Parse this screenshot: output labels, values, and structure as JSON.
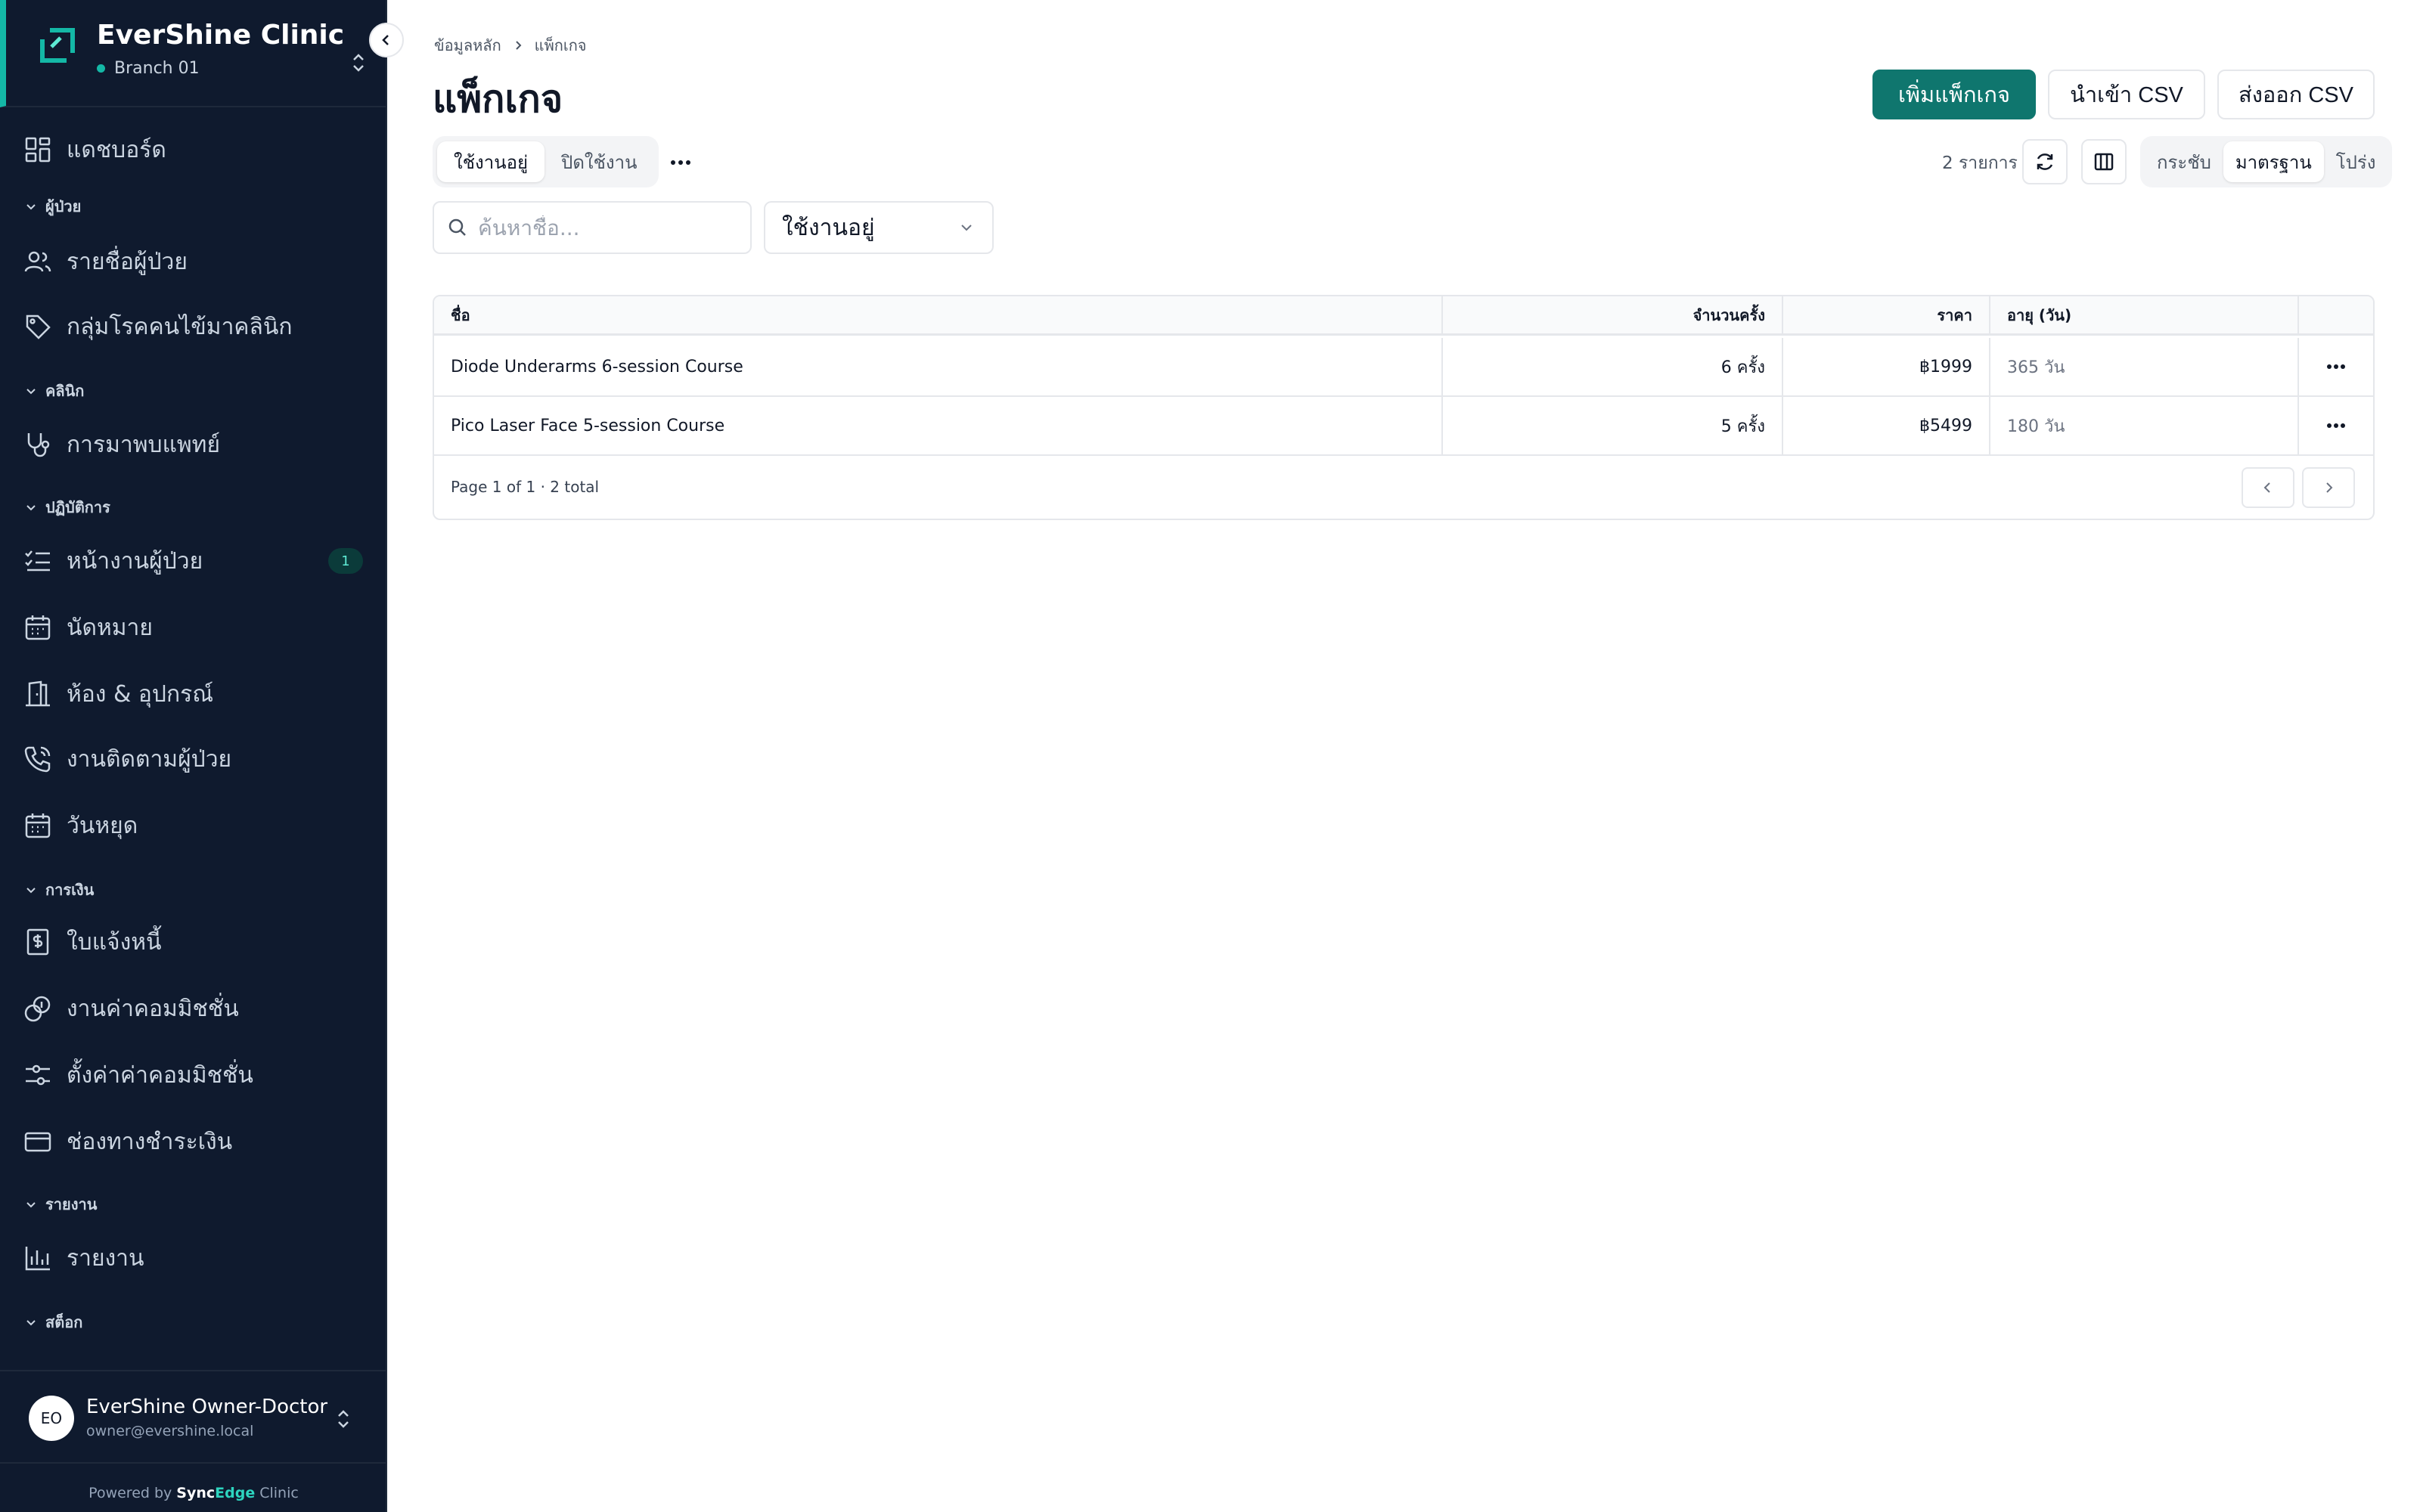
{
  "sidebar": {
    "brand_title": "EverShine Clinic",
    "branch": "Branch 01",
    "accent_color": "#14b8a6",
    "items": {
      "dashboard": "แดชบอร์ด",
      "section_patients": "ผู้ป่วย",
      "patient_list": "รายชื่อผู้ป่วย",
      "disease_groups": "กลุ่มโรคคนไข้มาคลินิก",
      "section_clinic": "คลินิก",
      "doctor_visits": "การมาพบแพทย์",
      "section_operations": "ปฏิบัติการ",
      "patient_tasks": "หน้างานผู้ป่วย",
      "patient_tasks_badge": "1",
      "appointments": "นัดหมาย",
      "rooms_equipment": "ห้อง & อุปกรณ์",
      "patient_followup": "งานติดตามผู้ป่วย",
      "holidays": "วันหยุด",
      "section_finance": "การเงิน",
      "invoices": "ใบแจ้งหนี้",
      "commission_jobs": "งานค่าคอมมิชชั่น",
      "commission_settings": "ตั้งค่าค่าคอมมิชชั่น",
      "payment_channels": "ช่องทางชำระเงิน",
      "section_reports": "รายงาน",
      "reports": "รายงาน",
      "section_stock": "สต็อก"
    },
    "user": {
      "initials": "EO",
      "name": "EverShine Owner-Doctor",
      "email": "owner@evershine.local"
    },
    "powered_prefix": "Powered by",
    "powered_brand_a": "Sync",
    "powered_brand_b": "Edge",
    "powered_suffix": "Clinic"
  },
  "breadcrumb": [
    "ข้อมูลหลัก",
    "แพ็กเกจ"
  ],
  "page_title": "แพ็กเกจ",
  "actions": {
    "add": "เพิ่มแพ็กเกจ",
    "import": "นำเข้า CSV",
    "export": "ส่งออก CSV",
    "primary_color": "#0f766e"
  },
  "status_tabs": {
    "active": "ใช้งานอยู่",
    "inactive": "ปิดใช้งาน"
  },
  "record_count": "2 รายการ",
  "density": {
    "compact": "กระชับ",
    "standard": "มาตรฐาน",
    "comfortable": "โปร่ง",
    "selected": "standard"
  },
  "search": {
    "placeholder": "ค้นหาชื่อ...",
    "value": ""
  },
  "status_filter": {
    "selected": "ใช้งานอยู่"
  },
  "table": {
    "columns": {
      "name": "ชื่อ",
      "sessions": "จำนวนครั้ง",
      "price": "ราคา",
      "validity": "อายุ (วัน)"
    },
    "rows": [
      {
        "name": "Diode Underarms 6-session Course",
        "sessions": "6 ครั้ง",
        "price": "฿1999",
        "validity": "365 วัน"
      },
      {
        "name": "Pico Laser Face 5-session Course",
        "sessions": "5 ครั้ง",
        "price": "฿5499",
        "validity": "180 วัน"
      }
    ],
    "footer": "Page 1 of 1 · 2 total"
  }
}
